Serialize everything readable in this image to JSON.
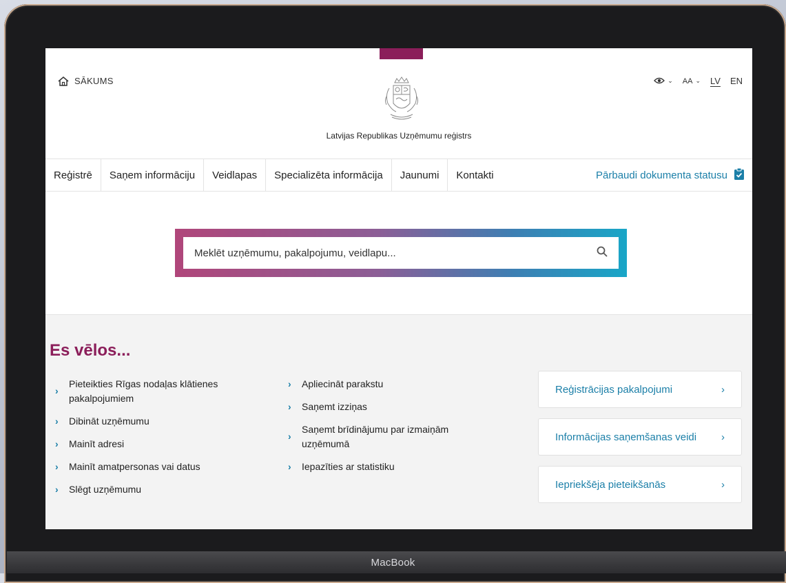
{
  "device": {
    "label": "MacBook"
  },
  "header": {
    "home_label": "SĀKUMS",
    "org_name": "Latvijas Republikas Uzņēmumu reģistrs",
    "font_size_label": "AA",
    "languages": [
      "LV",
      "EN"
    ]
  },
  "nav": {
    "items": [
      "Reģistrē",
      "Saņem informāciju",
      "Veidlapas",
      "Specializēta informācija",
      "Jaunumi",
      "Kontakti"
    ],
    "check_status": "Pārbaudi dokumenta statusu"
  },
  "search": {
    "placeholder": "Meklēt uzņēmumu, pakalpojumu, veidlapu..."
  },
  "wants": {
    "title": "Es vēlos...",
    "col1": [
      "Pieteikties Rīgas nodaļas klātienes pakalpojumiem",
      "Dibināt uzņēmumu",
      "Mainīt adresi",
      "Mainīt amatpersonas vai datus",
      "Slēgt uzņēmumu"
    ],
    "col2": [
      "Apliecināt parakstu",
      "Saņemt izziņas",
      "Saņemt brīdinājumu par izmaiņām uzņēmumā",
      "Iepazīties ar statistiku"
    ],
    "cards": [
      "Reģistrācijas pakalpojumi",
      "Informācijas saņemšanas veidi",
      "Iepriekšēja pieteikšanās"
    ]
  },
  "colors": {
    "brand": "#8b1e5a",
    "link": "#1b7fa8"
  }
}
